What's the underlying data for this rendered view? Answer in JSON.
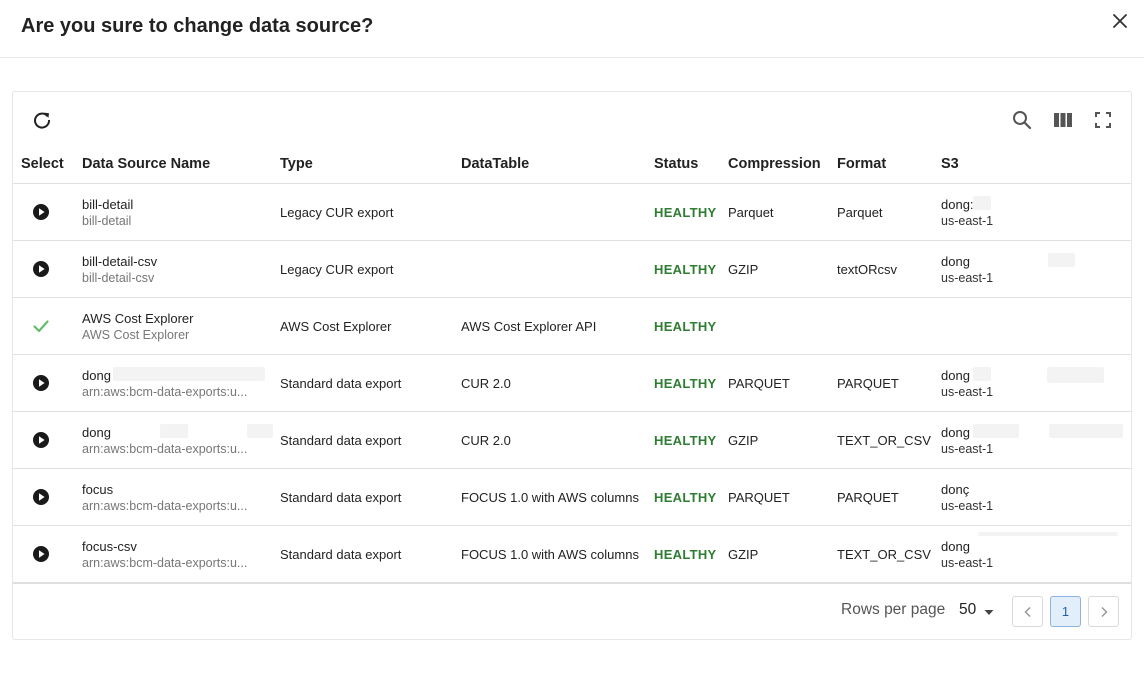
{
  "dialog": {
    "title": "Are you sure to change data source?"
  },
  "table": {
    "columns": [
      "Select",
      "Data Source Name",
      "Type",
      "DataTable",
      "Status",
      "Compression",
      "Format",
      "S3"
    ],
    "rows": [
      {
        "select_icon": "play-circle-icon",
        "name": "bill-detail",
        "subname": "bill-detail",
        "type": "Legacy CUR export",
        "datatable": "",
        "status": "HEALTHY",
        "compression": "Parquet",
        "format": "Parquet",
        "s3_bucket": "dong:",
        "s3_region": "us-east-1"
      },
      {
        "select_icon": "play-circle-icon",
        "name": "bill-detail-csv",
        "subname": "bill-detail-csv",
        "type": "Legacy CUR export",
        "datatable": "",
        "status": "HEALTHY",
        "compression": "GZIP",
        "format": "textORcsv",
        "s3_bucket": "dong",
        "s3_region": "us-east-1"
      },
      {
        "select_icon": "check-icon",
        "name": "AWS Cost Explorer",
        "subname": "AWS Cost Explorer",
        "type": "AWS Cost Explorer",
        "datatable": "AWS Cost Explorer API",
        "status": "HEALTHY",
        "compression": "",
        "format": "",
        "s3_bucket": "",
        "s3_region": ""
      },
      {
        "select_icon": "play-circle-icon",
        "name": "dong",
        "subname": "arn:aws:bcm-data-exports:u...",
        "type": "Standard data export",
        "datatable": "CUR 2.0",
        "status": "HEALTHY",
        "compression": "PARQUET",
        "format": "PARQUET",
        "s3_bucket": "dong",
        "s3_region": "us-east-1"
      },
      {
        "select_icon": "play-circle-icon",
        "name": "dong",
        "subname": "arn:aws:bcm-data-exports:u...",
        "type": "Standard data export",
        "datatable": "CUR 2.0",
        "status": "HEALTHY",
        "compression": "GZIP",
        "format": "TEXT_OR_CSV",
        "s3_bucket": "dong",
        "s3_region": "us-east-1"
      },
      {
        "select_icon": "play-circle-icon",
        "name": "focus",
        "subname": "arn:aws:bcm-data-exports:u...",
        "type": "Standard data export",
        "datatable": "FOCUS 1.0 with AWS columns",
        "status": "HEALTHY",
        "compression": "PARQUET",
        "format": "PARQUET",
        "s3_bucket": "donç",
        "s3_region": "us-east-1"
      },
      {
        "select_icon": "play-circle-icon",
        "name": "focus-csv",
        "subname": "arn:aws:bcm-data-exports:u...",
        "type": "Standard data export",
        "datatable": "FOCUS 1.0 with AWS columns",
        "status": "HEALTHY",
        "compression": "GZIP",
        "format": "TEXT_OR_CSV",
        "s3_bucket": "dong",
        "s3_region": "us-east-1"
      }
    ]
  },
  "pagination": {
    "rows_per_page_label": "Rows per page",
    "rows_per_page_value": "50",
    "current_page": "1"
  },
  "colors": {
    "status_healthy": "#2e7d32",
    "check": "#66bb6a",
    "page_active_bg": "#e3eefb"
  }
}
